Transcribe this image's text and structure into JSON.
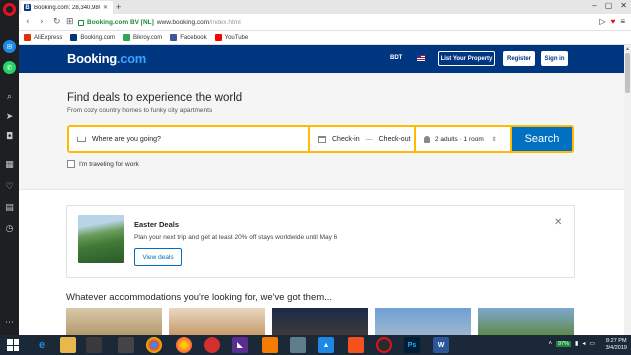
{
  "browser": {
    "tab_title": "Booking.com: 28,340,980",
    "tab_favicon": "B",
    "url_secure_label": "Booking.com BV [NL]",
    "url_domain": "www.booking.com",
    "url_path": "/index.html",
    "bookmarks": [
      {
        "label": "AliExpress",
        "color": "#e62e04"
      },
      {
        "label": "Booking.com",
        "color": "#003580"
      },
      {
        "label": "Bikroy.com",
        "color": "#2fa84f"
      },
      {
        "label": "Facebook",
        "color": "#3b5998"
      },
      {
        "label": "YouTube",
        "color": "#ff0000"
      }
    ]
  },
  "header": {
    "logo_main": "Booking",
    "logo_suffix": ".com",
    "currency": "BDT",
    "list_property": "List Your Property",
    "register": "Register",
    "sign_in": "Sign in"
  },
  "hero": {
    "title": "Find deals to experience the world",
    "subtitle": "From cozy country homes to funky city apartments",
    "destination_placeholder": "Where are you going?",
    "check_in": "Check-in",
    "date_separator": "—",
    "check_out": "Check-out",
    "guests": "2 adults · 1 room",
    "search_button": "Search",
    "travel_for_work": "I'm traveling for work"
  },
  "promo": {
    "title": "Easter Deals",
    "text": "Plan your next trip and get at least 20% off stays worldwide until May 6",
    "button": "View deals"
  },
  "section": {
    "title": "Whatever accommodations you're looking for, we've got them..."
  },
  "taskbar": {
    "battery": "97%",
    "time": "8:27 PM",
    "date": "3/4/2019"
  },
  "colors": {
    "brand_blue": "#003580",
    "search_yellow": "#febb02",
    "button_blue": "#0071c2"
  }
}
